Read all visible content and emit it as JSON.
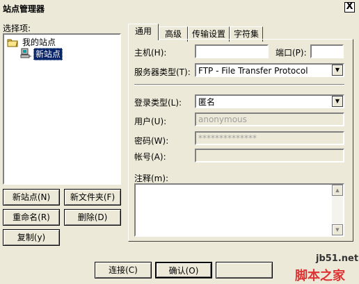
{
  "window": {
    "title": "站点管理器",
    "close_glyph": "X"
  },
  "left": {
    "select_label": "选择项:",
    "tree": [
      {
        "label": "我的站点",
        "icon": "folder-icon"
      },
      {
        "label": "新站点",
        "icon": "computer-icon",
        "selected": true
      }
    ],
    "buttons": {
      "new_site": "新站点(N)",
      "new_folder": "新文件夹(F)",
      "rename": "重命名(R)",
      "delete": "删除(D)",
      "copy": "复制(y)"
    }
  },
  "tabs": [
    "通用",
    "高级",
    "传输设置",
    "字符集"
  ],
  "active_tab": "通用",
  "general": {
    "host_label": "主机(H):",
    "host_value": "",
    "port_label": "端口(P):",
    "port_value": "",
    "server_type_label": "服务器类型(T):",
    "server_type_value": "FTP - File Transfer Protocol",
    "logon_type_label": "登录类型(L):",
    "logon_type_value": "匿名",
    "user_label": "用户(U):",
    "user_value": "anonymous",
    "password_label": "密码(W):",
    "password_value": "**************",
    "account_label": "帐号(A):",
    "account_value": "",
    "comments_label": "注释(m):",
    "comments_value": ""
  },
  "footer": {
    "connect": "连接(C)",
    "ok": "确认(O)"
  },
  "watermark": {
    "site": "jb51.net",
    "name": "脚本之家"
  },
  "colors": {
    "dialog_bg": "#ece9d8",
    "selection_bg": "#0a246a",
    "selection_fg": "#ffffff"
  }
}
